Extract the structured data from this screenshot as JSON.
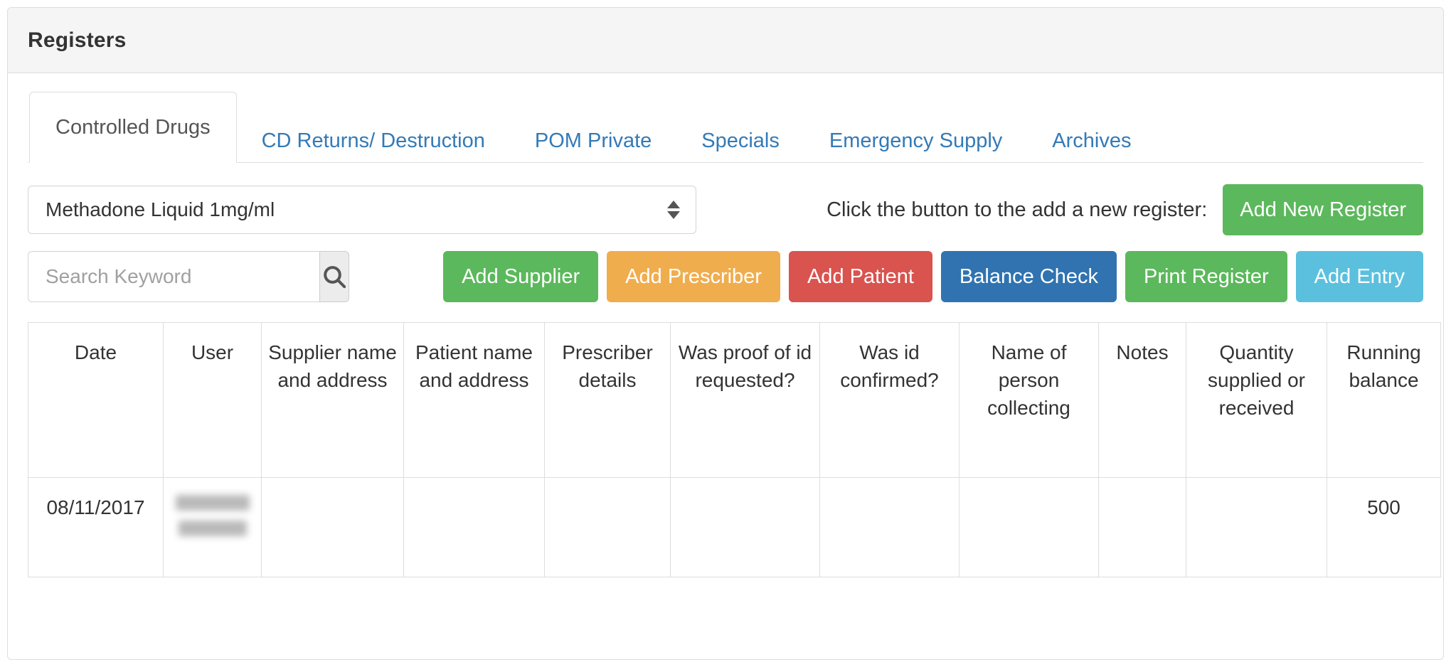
{
  "header": {
    "title": "Registers"
  },
  "tabs": [
    {
      "label": "Controlled Drugs",
      "active": true
    },
    {
      "label": "CD Returns/ Destruction",
      "active": false
    },
    {
      "label": "POM Private",
      "active": false
    },
    {
      "label": "Specials",
      "active": false
    },
    {
      "label": "Emergency Supply",
      "active": false
    },
    {
      "label": "Archives",
      "active": false
    }
  ],
  "drug_select": {
    "value": "Methadone Liquid 1mg/ml",
    "icon": "updown-spinner-icon"
  },
  "add_register": {
    "label": "Click the button to the add a new register:",
    "button_label": "Add New Register",
    "color": "#5cb85c"
  },
  "search": {
    "value": "",
    "placeholder": "Search Keyword",
    "icon": "search-icon"
  },
  "action_buttons": [
    {
      "label": "Add Supplier",
      "color": "#5cb85c"
    },
    {
      "label": "Add Prescriber",
      "color": "#f0ad4e"
    },
    {
      "label": "Add Patient",
      "color": "#d9534f"
    },
    {
      "label": "Balance Check",
      "color": "#3073b0"
    },
    {
      "label": "Print Register",
      "color": "#5cb85c"
    },
    {
      "label": "Add Entry",
      "color": "#5bc0de"
    }
  ],
  "table": {
    "columns": [
      "Date",
      "User",
      "Supplier name and address",
      "Patient name and address",
      "Prescriber details",
      "Was proof of id requested?",
      "Was id confirmed?",
      "Name of person collecting",
      "Notes",
      "Quantity supplied or received",
      "Running balance"
    ],
    "rows": [
      {
        "date": "08/11/2017",
        "user": "",
        "user_redacted": true,
        "supplier": "",
        "patient": "",
        "prescriber": "",
        "proof_of_id": "",
        "id_confirmed": "",
        "person_collecting": "",
        "notes": "",
        "quantity": "",
        "running_balance": "500"
      }
    ]
  },
  "colors": {
    "link": "#337ab7",
    "header_bg": "#f5f5f5",
    "border": "#dddddd",
    "text": "#333333"
  }
}
